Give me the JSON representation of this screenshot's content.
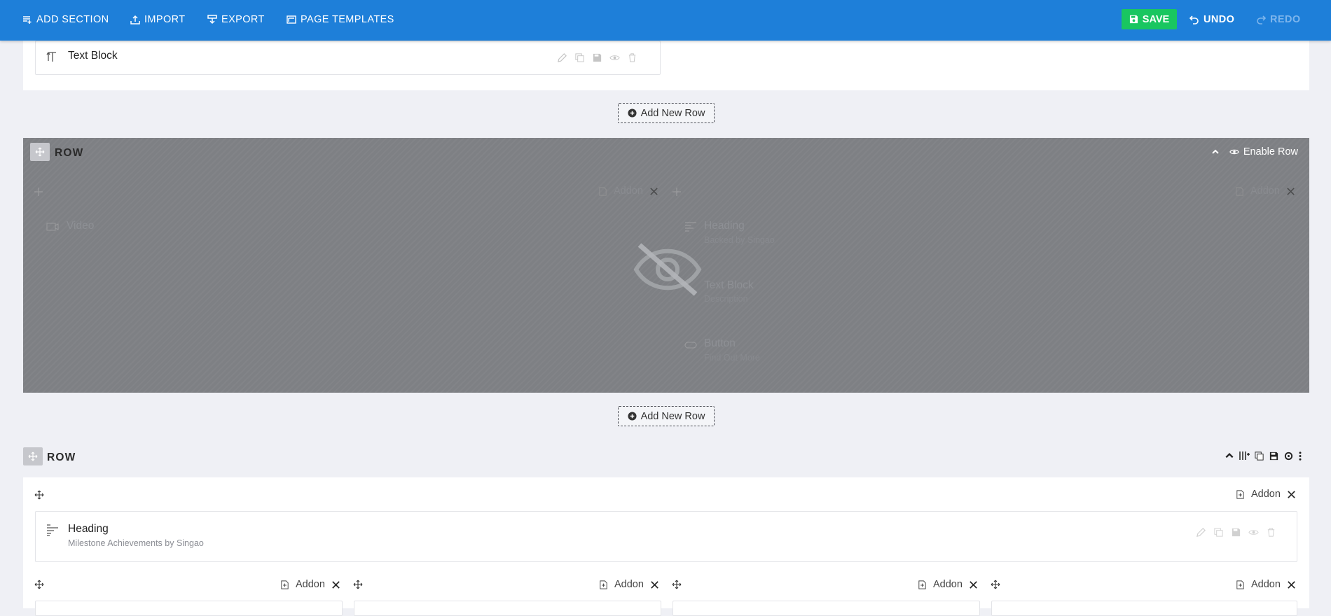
{
  "toolbar": {
    "add_section": "ADD SECTION",
    "import": "IMPORT",
    "export": "EXPORT",
    "page_templates": "PAGE TEMPLATES",
    "save": "SAVE",
    "undo": "UNDO",
    "redo": "REDO"
  },
  "top_section": {
    "addon_title": "Text Block"
  },
  "add_new_row_label": "Add New Row",
  "disabled_row": {
    "label": "ROW",
    "enable_label": "Enable Row",
    "addon_label": "Addon",
    "col1_addons": [
      {
        "title": "Video",
        "sub": ""
      }
    ],
    "col2_addons": [
      {
        "title": "Heading",
        "sub": "Backed by Singao"
      },
      {
        "title": "Text Block",
        "sub": "Description"
      },
      {
        "title": "Button",
        "sub": "Find Out More"
      }
    ]
  },
  "bottom_row": {
    "label": "ROW",
    "addon_label": "Addon",
    "heading_title": "Heading",
    "heading_sub": "Milestone Achievements by Singao"
  },
  "colors": {
    "toolbar_bg": "#1e7fd9",
    "save_bg": "#19c660",
    "page_bg": "#eff0f5",
    "disabled_overlay": "#7e8084"
  },
  "icons": [
    "add-section-icon",
    "import-icon",
    "export-icon",
    "page-templates-icon",
    "save-icon",
    "undo-icon",
    "redo-icon",
    "move-icon",
    "edit-icon",
    "duplicate-icon",
    "save-addon-icon",
    "eye-icon",
    "trash-icon",
    "plus-circle-icon",
    "chevron-up-icon",
    "eye-slash-icon",
    "add-addon-icon",
    "tools-icon",
    "columns-icon",
    "gear-icon",
    "more-vertical-icon"
  ]
}
